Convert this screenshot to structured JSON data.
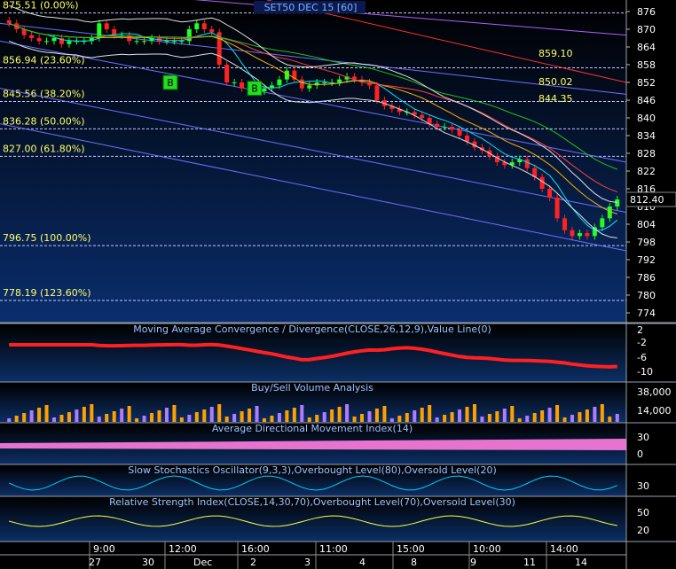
{
  "chart_data": {
    "type": "candlestick",
    "title": "SET50 DEC 15  [60]",
    "price_axis": {
      "ylim": [
        770,
        880
      ],
      "ticks": [
        876,
        870,
        864,
        858,
        852,
        846,
        840,
        834,
        828,
        822,
        816,
        810,
        804,
        798,
        792,
        786,
        780,
        774
      ]
    },
    "last_price": "812.40",
    "fib_levels": [
      {
        "label": "875.51 (0.00%)",
        "value": 875.51
      },
      {
        "label": "856.94 (23.60%)",
        "value": 856.94
      },
      {
        "label": "845.56 (38.20%)",
        "value": 845.56
      },
      {
        "label": "836.28 (50.00%)",
        "value": 836.28
      },
      {
        "label": "827.00 (61.80%)",
        "value": 827.0
      },
      {
        "label": "796.75 (100.00%)",
        "value": 796.75
      },
      {
        "label": "778.19 (123.60%)",
        "value": 778.19
      }
    ],
    "price_annotations": [
      "859.10",
      "850.02",
      "844.35"
    ],
    "signals": [
      "B",
      "B"
    ],
    "candles_close": [
      872,
      870,
      868,
      867,
      866,
      866,
      867,
      865,
      866,
      866,
      866,
      867,
      872,
      870,
      868,
      868,
      866,
      866,
      866,
      867,
      866,
      866,
      866,
      866,
      870,
      872,
      870,
      869,
      858,
      852,
      852,
      850,
      849,
      849,
      850,
      851,
      853,
      856,
      853,
      850,
      851,
      852,
      852,
      852,
      853,
      854,
      853,
      852,
      851,
      846,
      844,
      843,
      842,
      842,
      841,
      840,
      838,
      837,
      837,
      836,
      834,
      832,
      830,
      829,
      827,
      825,
      824,
      825,
      826,
      823,
      820,
      816,
      813,
      806,
      802,
      800,
      801,
      800,
      803,
      806,
      810,
      812.4
    ],
    "panels": [
      {
        "title": "Moving Average Convergence / Divergence(CLOSE,26,12,9),Value Line(0)",
        "ticks": [
          "2",
          "-2",
          "-6",
          "-10"
        ]
      },
      {
        "title": "Buy/Sell Volume Analysis",
        "ticks": [
          "38,000",
          "14,000"
        ]
      },
      {
        "title": "Average Directional Movement Index(14)",
        "ticks": [
          "30",
          "0"
        ]
      },
      {
        "title": "Slow Stochastics Oscillator(9,3,3),Overbought Level(80),Oversold Level(20)",
        "ticks": [
          "30"
        ]
      },
      {
        "title": "Relative Strength Index(CLOSE,14,30,70),Overbought Level(70),Oversold Level(30)",
        "ticks": [
          "50",
          "20"
        ]
      }
    ],
    "time_labels": [
      "9:00",
      "12:00",
      "16:00",
      "11:00",
      "15:00",
      "10:00",
      "14:00"
    ],
    "date_labels": [
      "27",
      "30",
      "Dec",
      "2",
      "3",
      "4",
      "8",
      "9",
      "11",
      "14"
    ]
  }
}
